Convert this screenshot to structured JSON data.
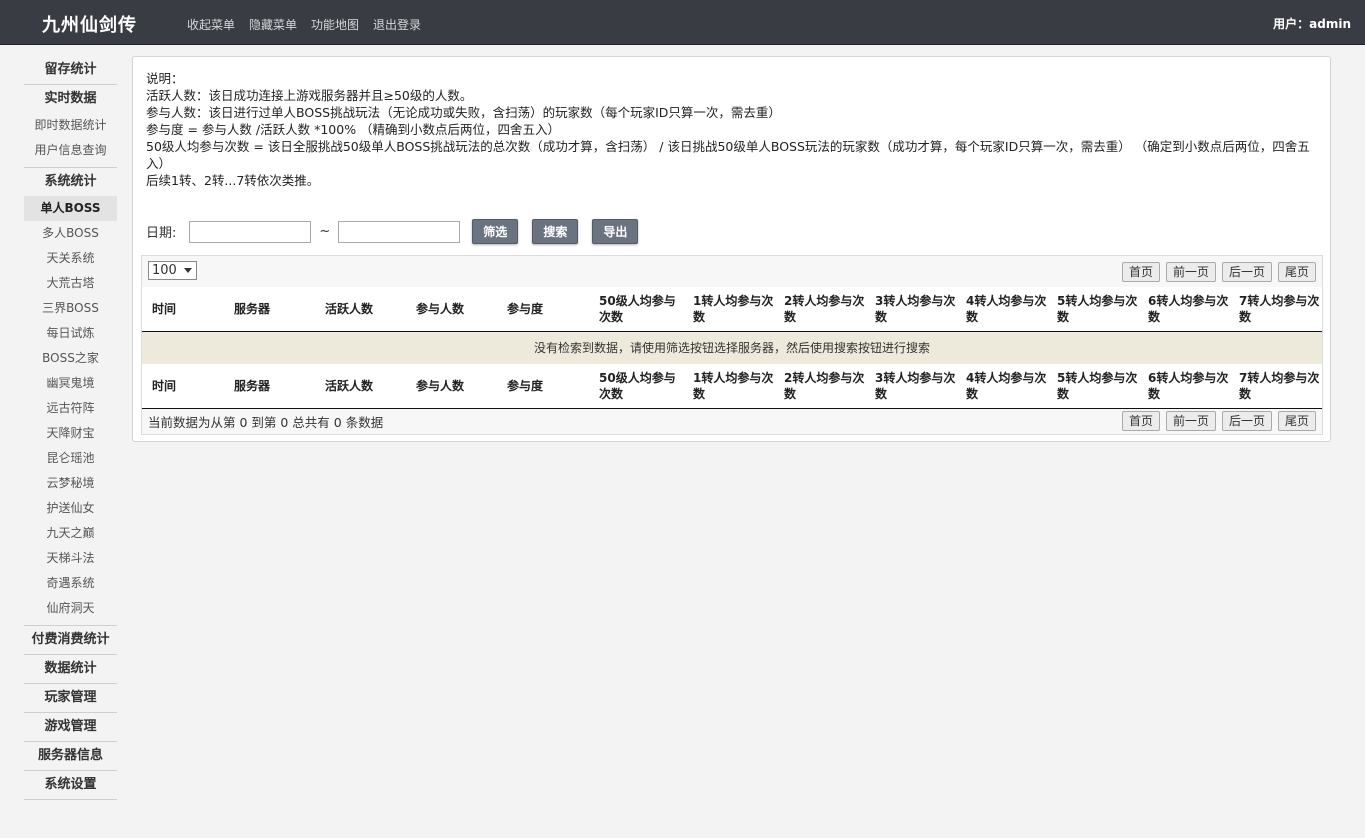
{
  "header": {
    "brand": "九州仙剑传",
    "nav": [
      "收起菜单",
      "隐藏菜单",
      "功能地图",
      "退出登录"
    ],
    "user_label": "用户：",
    "user_name": "admin"
  },
  "sidebar": {
    "g_retention": "留存统计",
    "g_realtime": "实时数据",
    "realtime_items": [
      "即时数据统计",
      "用户信息查询"
    ],
    "g_system": "系统统计",
    "system_items": [
      "单人BOSS",
      "多人BOSS",
      "天关系统",
      "大荒古塔",
      "三界BOSS",
      "每日试炼",
      "BOSS之家",
      "幽冥鬼境",
      "远古符阵",
      "天降财宝",
      "昆仑瑶池",
      "云梦秘境",
      "护送仙女",
      "九天之巅",
      "天梯斗法",
      "奇遇系统",
      "仙府洞天"
    ],
    "groups_rest": [
      "付费消费统计",
      "数据统计",
      "玩家管理",
      "游戏管理",
      "服务器信息",
      "系统设置"
    ]
  },
  "desc": [
    "说明：",
    "活跃人数：该日成功连接上游戏服务器并且≥50级的人数。",
    "参与人数：该日进行过单人BOSS挑战玩法（无论成功或失败，含扫荡）的玩家数（每个玩家ID只算一次，需去重）",
    "参与度 = 参与人数 /活跃人数 *100% （精确到小数点后两位，四舍五入）",
    "50级人均参与次数 = 该日全服挑战50级单人BOSS挑战玩法的总次数（成功才算，含扫荡） / 该日挑战50级单人BOSS玩法的玩家数（成功才算，每个玩家ID只算一次，需去重） （确定到小数点后两位，四舍五入）",
    "后续1转、2转...7转依次类推。"
  ],
  "filter": {
    "date_label": "日期:",
    "tilde": "~",
    "btn_filter": "筛选",
    "btn_search": "搜索",
    "btn_export": "导出"
  },
  "table": {
    "page_size": "100",
    "pager": [
      "首页",
      "前一页",
      "后一页",
      "尾页"
    ],
    "columns": [
      "时间",
      "服务器",
      "活跃人数",
      "参与人数",
      "参与度",
      "50级人均参与次数",
      "1转人均参与次数",
      "2转人均参与次数",
      "3转人均参与次数",
      "4转人均参与次数",
      "5转人均参与次数",
      "6转人均参与次数",
      "7转人均参与次数"
    ],
    "empty_text": "没有检索到数据，请使用筛选按钮选择服务器，然后使用搜索按钮进行搜索",
    "info": "当前数据为从第 0 到第 0 总共有 0 条数据"
  }
}
